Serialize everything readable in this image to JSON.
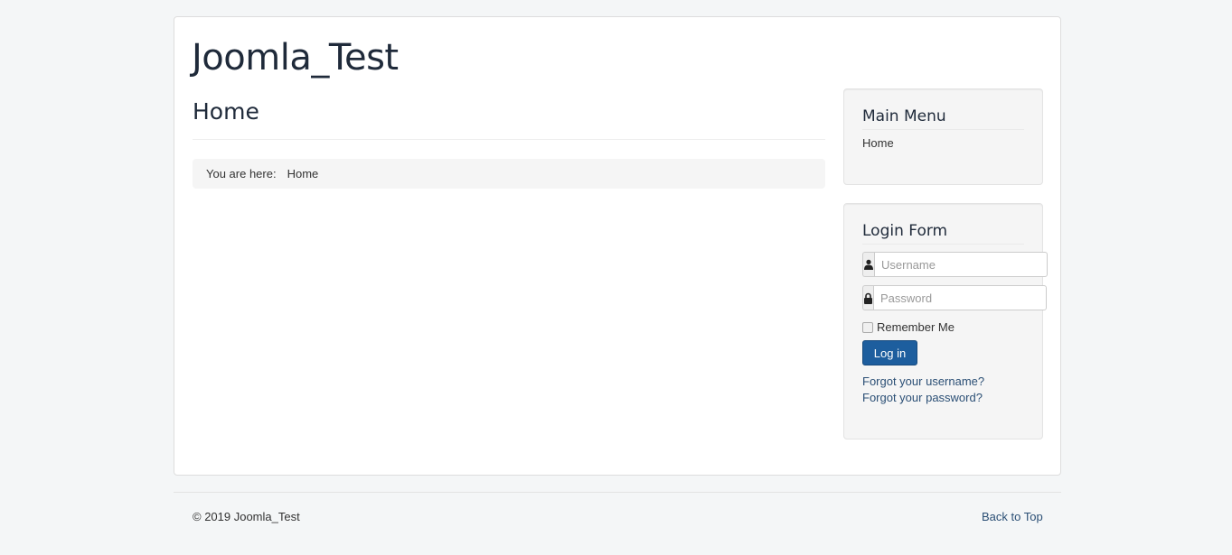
{
  "site": {
    "brand": "Joomla_Test"
  },
  "content": {
    "page_title": "Home",
    "breadcrumb": {
      "label": "You are here:",
      "items": [
        "Home"
      ]
    }
  },
  "sidebar": {
    "main_menu": {
      "title": "Main Menu",
      "items": [
        {
          "label": "Home"
        }
      ]
    },
    "login_form": {
      "title": "Login Form",
      "username": {
        "placeholder": "Username",
        "value": "",
        "icon": "user-icon"
      },
      "password": {
        "placeholder": "Password",
        "value": "",
        "icon": "lock-icon"
      },
      "remember_label": "Remember Me",
      "remember_checked": false,
      "login_label": "Log in",
      "forgot_username": "Forgot your username?",
      "forgot_password": "Forgot your password?"
    }
  },
  "footer": {
    "copyright": "© 2019 Joomla_Test",
    "back_to_top": "Back to Top"
  },
  "colors": {
    "background": "#f4f6f7",
    "card": "#ffffff",
    "well": "#f5f5f5",
    "button": "#1d5e9e",
    "link": "#2b4f75",
    "heading": "#1f2a3a"
  }
}
